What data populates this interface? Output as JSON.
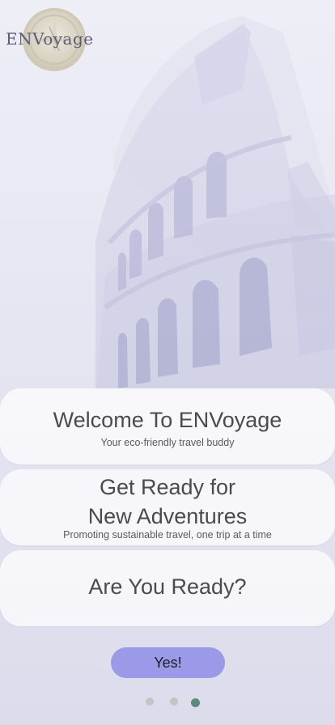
{
  "app": {
    "logo_text": "ENVoyage"
  },
  "cards": [
    {
      "title": "Welcome To ENVoyage",
      "subtitle": "Your eco-friendly travel buddy"
    },
    {
      "title_line1": "Get Ready for",
      "title_line2": "New Adventures",
      "subtitle": "Promoting sustainable travel, one trip at a time"
    },
    {
      "title": "Are You Ready?"
    }
  ],
  "cta": {
    "label": "Yes!"
  },
  "pager": {
    "count": 3,
    "active_index": 2
  },
  "colors": {
    "button": "#9a9ae8",
    "dot_active": "#5d8a7a",
    "dot_inactive": "#c4c4c4",
    "illustration": "#c9c9e2"
  },
  "icons": {
    "logo": "compass-badge-icon",
    "background": "colosseum-illustration"
  }
}
